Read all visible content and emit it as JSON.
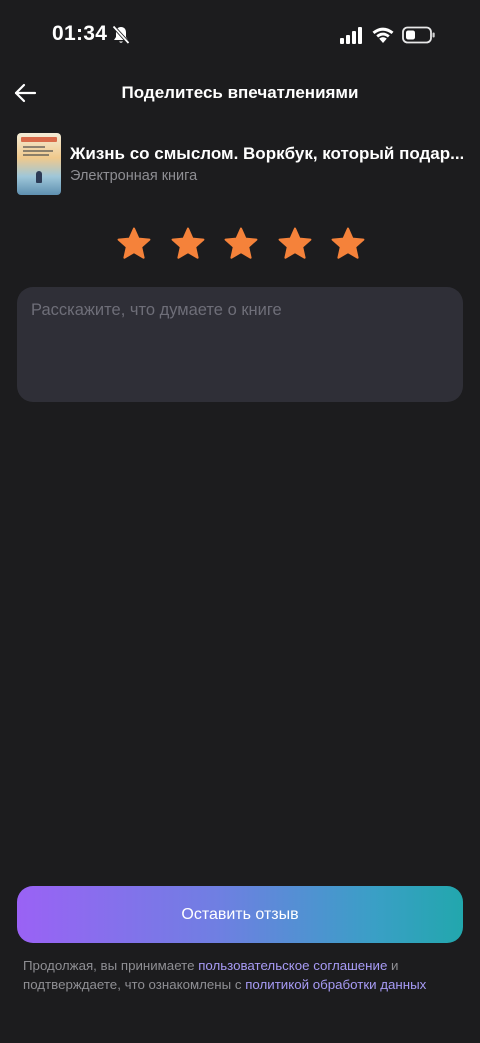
{
  "status_bar": {
    "time": "01:34",
    "icons": [
      "bell-slash-icon",
      "signal-icon",
      "wifi-icon",
      "battery-icon"
    ]
  },
  "header": {
    "title": "Поделитесь впечатлениями",
    "back_icon": "arrow-left-icon"
  },
  "book": {
    "title": "Жизнь со смыслом. Воркбук, который подар...",
    "type": "Электронная книга"
  },
  "rating": {
    "value": 5,
    "max": 5,
    "star_color": "#f5823a"
  },
  "review": {
    "value": "",
    "placeholder": "Расскажите, что думаете о книге"
  },
  "submit": {
    "label": "Оставить отзыв"
  },
  "legal": {
    "text_1": "Продолжая, вы принимаете ",
    "link_1": "пользовательское соглашение",
    "text_2": " и подтверждаете, что ознакомлены с ",
    "link_2": "политикой обработки данных"
  },
  "colors": {
    "background": "#1c1c1e",
    "input_background": "#2f2f37",
    "link": "#a79bf5",
    "button_gradient_start": "#9a62f5",
    "button_gradient_end": "#22a7ad"
  }
}
